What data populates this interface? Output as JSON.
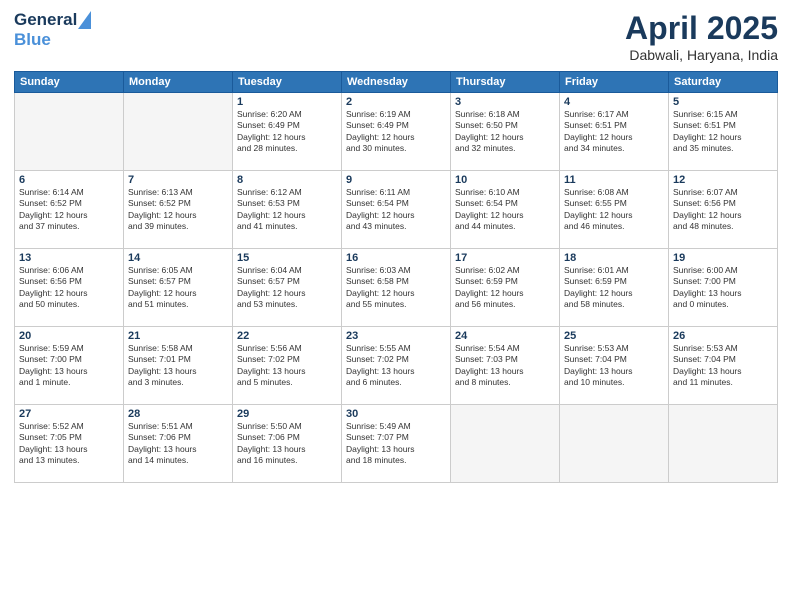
{
  "header": {
    "logo_general": "General",
    "logo_blue": "Blue",
    "title": "April 2025",
    "subtitle": "Dabwali, Haryana, India"
  },
  "days_of_week": [
    "Sunday",
    "Monday",
    "Tuesday",
    "Wednesday",
    "Thursday",
    "Friday",
    "Saturday"
  ],
  "weeks": [
    [
      {
        "day": "",
        "info": ""
      },
      {
        "day": "",
        "info": ""
      },
      {
        "day": "1",
        "info": "Sunrise: 6:20 AM\nSunset: 6:49 PM\nDaylight: 12 hours\nand 28 minutes."
      },
      {
        "day": "2",
        "info": "Sunrise: 6:19 AM\nSunset: 6:49 PM\nDaylight: 12 hours\nand 30 minutes."
      },
      {
        "day": "3",
        "info": "Sunrise: 6:18 AM\nSunset: 6:50 PM\nDaylight: 12 hours\nand 32 minutes."
      },
      {
        "day": "4",
        "info": "Sunrise: 6:17 AM\nSunset: 6:51 PM\nDaylight: 12 hours\nand 34 minutes."
      },
      {
        "day": "5",
        "info": "Sunrise: 6:15 AM\nSunset: 6:51 PM\nDaylight: 12 hours\nand 35 minutes."
      }
    ],
    [
      {
        "day": "6",
        "info": "Sunrise: 6:14 AM\nSunset: 6:52 PM\nDaylight: 12 hours\nand 37 minutes."
      },
      {
        "day": "7",
        "info": "Sunrise: 6:13 AM\nSunset: 6:52 PM\nDaylight: 12 hours\nand 39 minutes."
      },
      {
        "day": "8",
        "info": "Sunrise: 6:12 AM\nSunset: 6:53 PM\nDaylight: 12 hours\nand 41 minutes."
      },
      {
        "day": "9",
        "info": "Sunrise: 6:11 AM\nSunset: 6:54 PM\nDaylight: 12 hours\nand 43 minutes."
      },
      {
        "day": "10",
        "info": "Sunrise: 6:10 AM\nSunset: 6:54 PM\nDaylight: 12 hours\nand 44 minutes."
      },
      {
        "day": "11",
        "info": "Sunrise: 6:08 AM\nSunset: 6:55 PM\nDaylight: 12 hours\nand 46 minutes."
      },
      {
        "day": "12",
        "info": "Sunrise: 6:07 AM\nSunset: 6:56 PM\nDaylight: 12 hours\nand 48 minutes."
      }
    ],
    [
      {
        "day": "13",
        "info": "Sunrise: 6:06 AM\nSunset: 6:56 PM\nDaylight: 12 hours\nand 50 minutes."
      },
      {
        "day": "14",
        "info": "Sunrise: 6:05 AM\nSunset: 6:57 PM\nDaylight: 12 hours\nand 51 minutes."
      },
      {
        "day": "15",
        "info": "Sunrise: 6:04 AM\nSunset: 6:57 PM\nDaylight: 12 hours\nand 53 minutes."
      },
      {
        "day": "16",
        "info": "Sunrise: 6:03 AM\nSunset: 6:58 PM\nDaylight: 12 hours\nand 55 minutes."
      },
      {
        "day": "17",
        "info": "Sunrise: 6:02 AM\nSunset: 6:59 PM\nDaylight: 12 hours\nand 56 minutes."
      },
      {
        "day": "18",
        "info": "Sunrise: 6:01 AM\nSunset: 6:59 PM\nDaylight: 12 hours\nand 58 minutes."
      },
      {
        "day": "19",
        "info": "Sunrise: 6:00 AM\nSunset: 7:00 PM\nDaylight: 13 hours\nand 0 minutes."
      }
    ],
    [
      {
        "day": "20",
        "info": "Sunrise: 5:59 AM\nSunset: 7:00 PM\nDaylight: 13 hours\nand 1 minute."
      },
      {
        "day": "21",
        "info": "Sunrise: 5:58 AM\nSunset: 7:01 PM\nDaylight: 13 hours\nand 3 minutes."
      },
      {
        "day": "22",
        "info": "Sunrise: 5:56 AM\nSunset: 7:02 PM\nDaylight: 13 hours\nand 5 minutes."
      },
      {
        "day": "23",
        "info": "Sunrise: 5:55 AM\nSunset: 7:02 PM\nDaylight: 13 hours\nand 6 minutes."
      },
      {
        "day": "24",
        "info": "Sunrise: 5:54 AM\nSunset: 7:03 PM\nDaylight: 13 hours\nand 8 minutes."
      },
      {
        "day": "25",
        "info": "Sunrise: 5:53 AM\nSunset: 7:04 PM\nDaylight: 13 hours\nand 10 minutes."
      },
      {
        "day": "26",
        "info": "Sunrise: 5:53 AM\nSunset: 7:04 PM\nDaylight: 13 hours\nand 11 minutes."
      }
    ],
    [
      {
        "day": "27",
        "info": "Sunrise: 5:52 AM\nSunset: 7:05 PM\nDaylight: 13 hours\nand 13 minutes."
      },
      {
        "day": "28",
        "info": "Sunrise: 5:51 AM\nSunset: 7:06 PM\nDaylight: 13 hours\nand 14 minutes."
      },
      {
        "day": "29",
        "info": "Sunrise: 5:50 AM\nSunset: 7:06 PM\nDaylight: 13 hours\nand 16 minutes."
      },
      {
        "day": "30",
        "info": "Sunrise: 5:49 AM\nSunset: 7:07 PM\nDaylight: 13 hours\nand 18 minutes."
      },
      {
        "day": "",
        "info": ""
      },
      {
        "day": "",
        "info": ""
      },
      {
        "day": "",
        "info": ""
      }
    ]
  ]
}
